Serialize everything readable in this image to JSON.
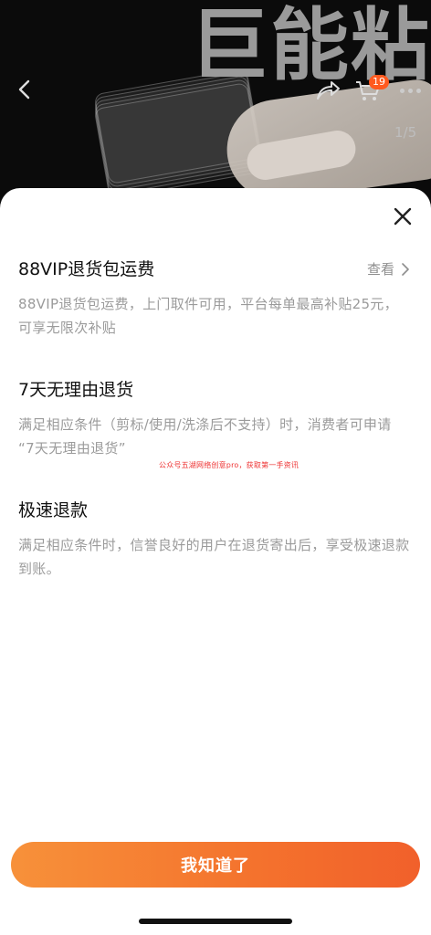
{
  "hero": {
    "title": "巨能粘",
    "overlay_text": "",
    "cart_count": "19",
    "pager": "1/5",
    "icons": {
      "back": "chevron-left-icon",
      "share": "share-icon",
      "cart": "cart-icon",
      "more": "more-dots-icon"
    }
  },
  "sheet": {
    "close_icon": "close-icon",
    "items": [
      {
        "title": "88VIP退货包运费",
        "link": "查看",
        "desc": "88VIP退货包运费，上门取件可用，平台每单最高补贴25元，可享无限次补贴"
      },
      {
        "title": "7天无理由退货",
        "desc": "满足相应条件（剪标/使用/洗涤后不支持）时，消费者可申请 “7天无理由退货”"
      },
      {
        "title": "极速退款",
        "desc": "满足相应条件时，信誉良好的用户在退货寄出后，享受极速退款到账。"
      }
    ],
    "watermark": "公众号五湖网络创意pro，获取第一手资讯",
    "confirm_label": "我知道了"
  },
  "colors": {
    "accent": "#f4722d",
    "badge": "#ff5a1f"
  }
}
